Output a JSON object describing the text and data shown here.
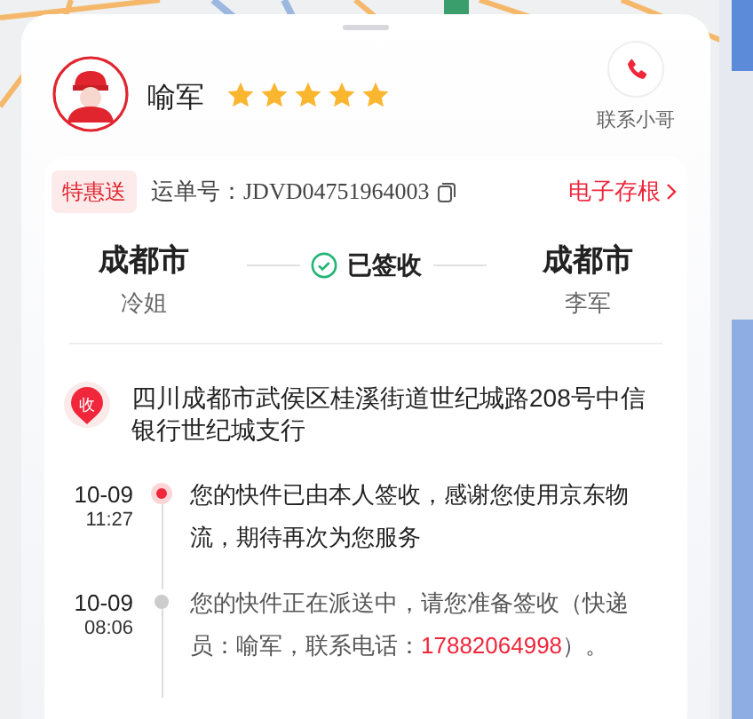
{
  "courier": {
    "name": "喻军",
    "stars": 5,
    "contact_label": "联系小哥"
  },
  "waybill": {
    "service_badge": "特惠送",
    "label": "运单号：",
    "number": "JDVD04751964003",
    "receipt_link": "电子存根"
  },
  "route": {
    "from_city": "成都市",
    "from_name": "冷姐",
    "status": "已签收",
    "to_city": "成都市",
    "to_name": "李军"
  },
  "address": {
    "badge": "收",
    "text": "四川成都市武侯区桂溪街道世纪城路208号中信银行世纪城支行"
  },
  "timeline": [
    {
      "date": "10-09",
      "time": "11:27",
      "current": true,
      "text": "您的快件已由本人签收，感谢您使用京东物流，期待再次为您服务"
    },
    {
      "date": "10-09",
      "time": "08:06",
      "current": false,
      "text": "您的快件正在派送中，请您准备签收（快递员：喻军，联系电话：",
      "phone": "17882064998",
      "text_after": "）。"
    }
  ]
}
